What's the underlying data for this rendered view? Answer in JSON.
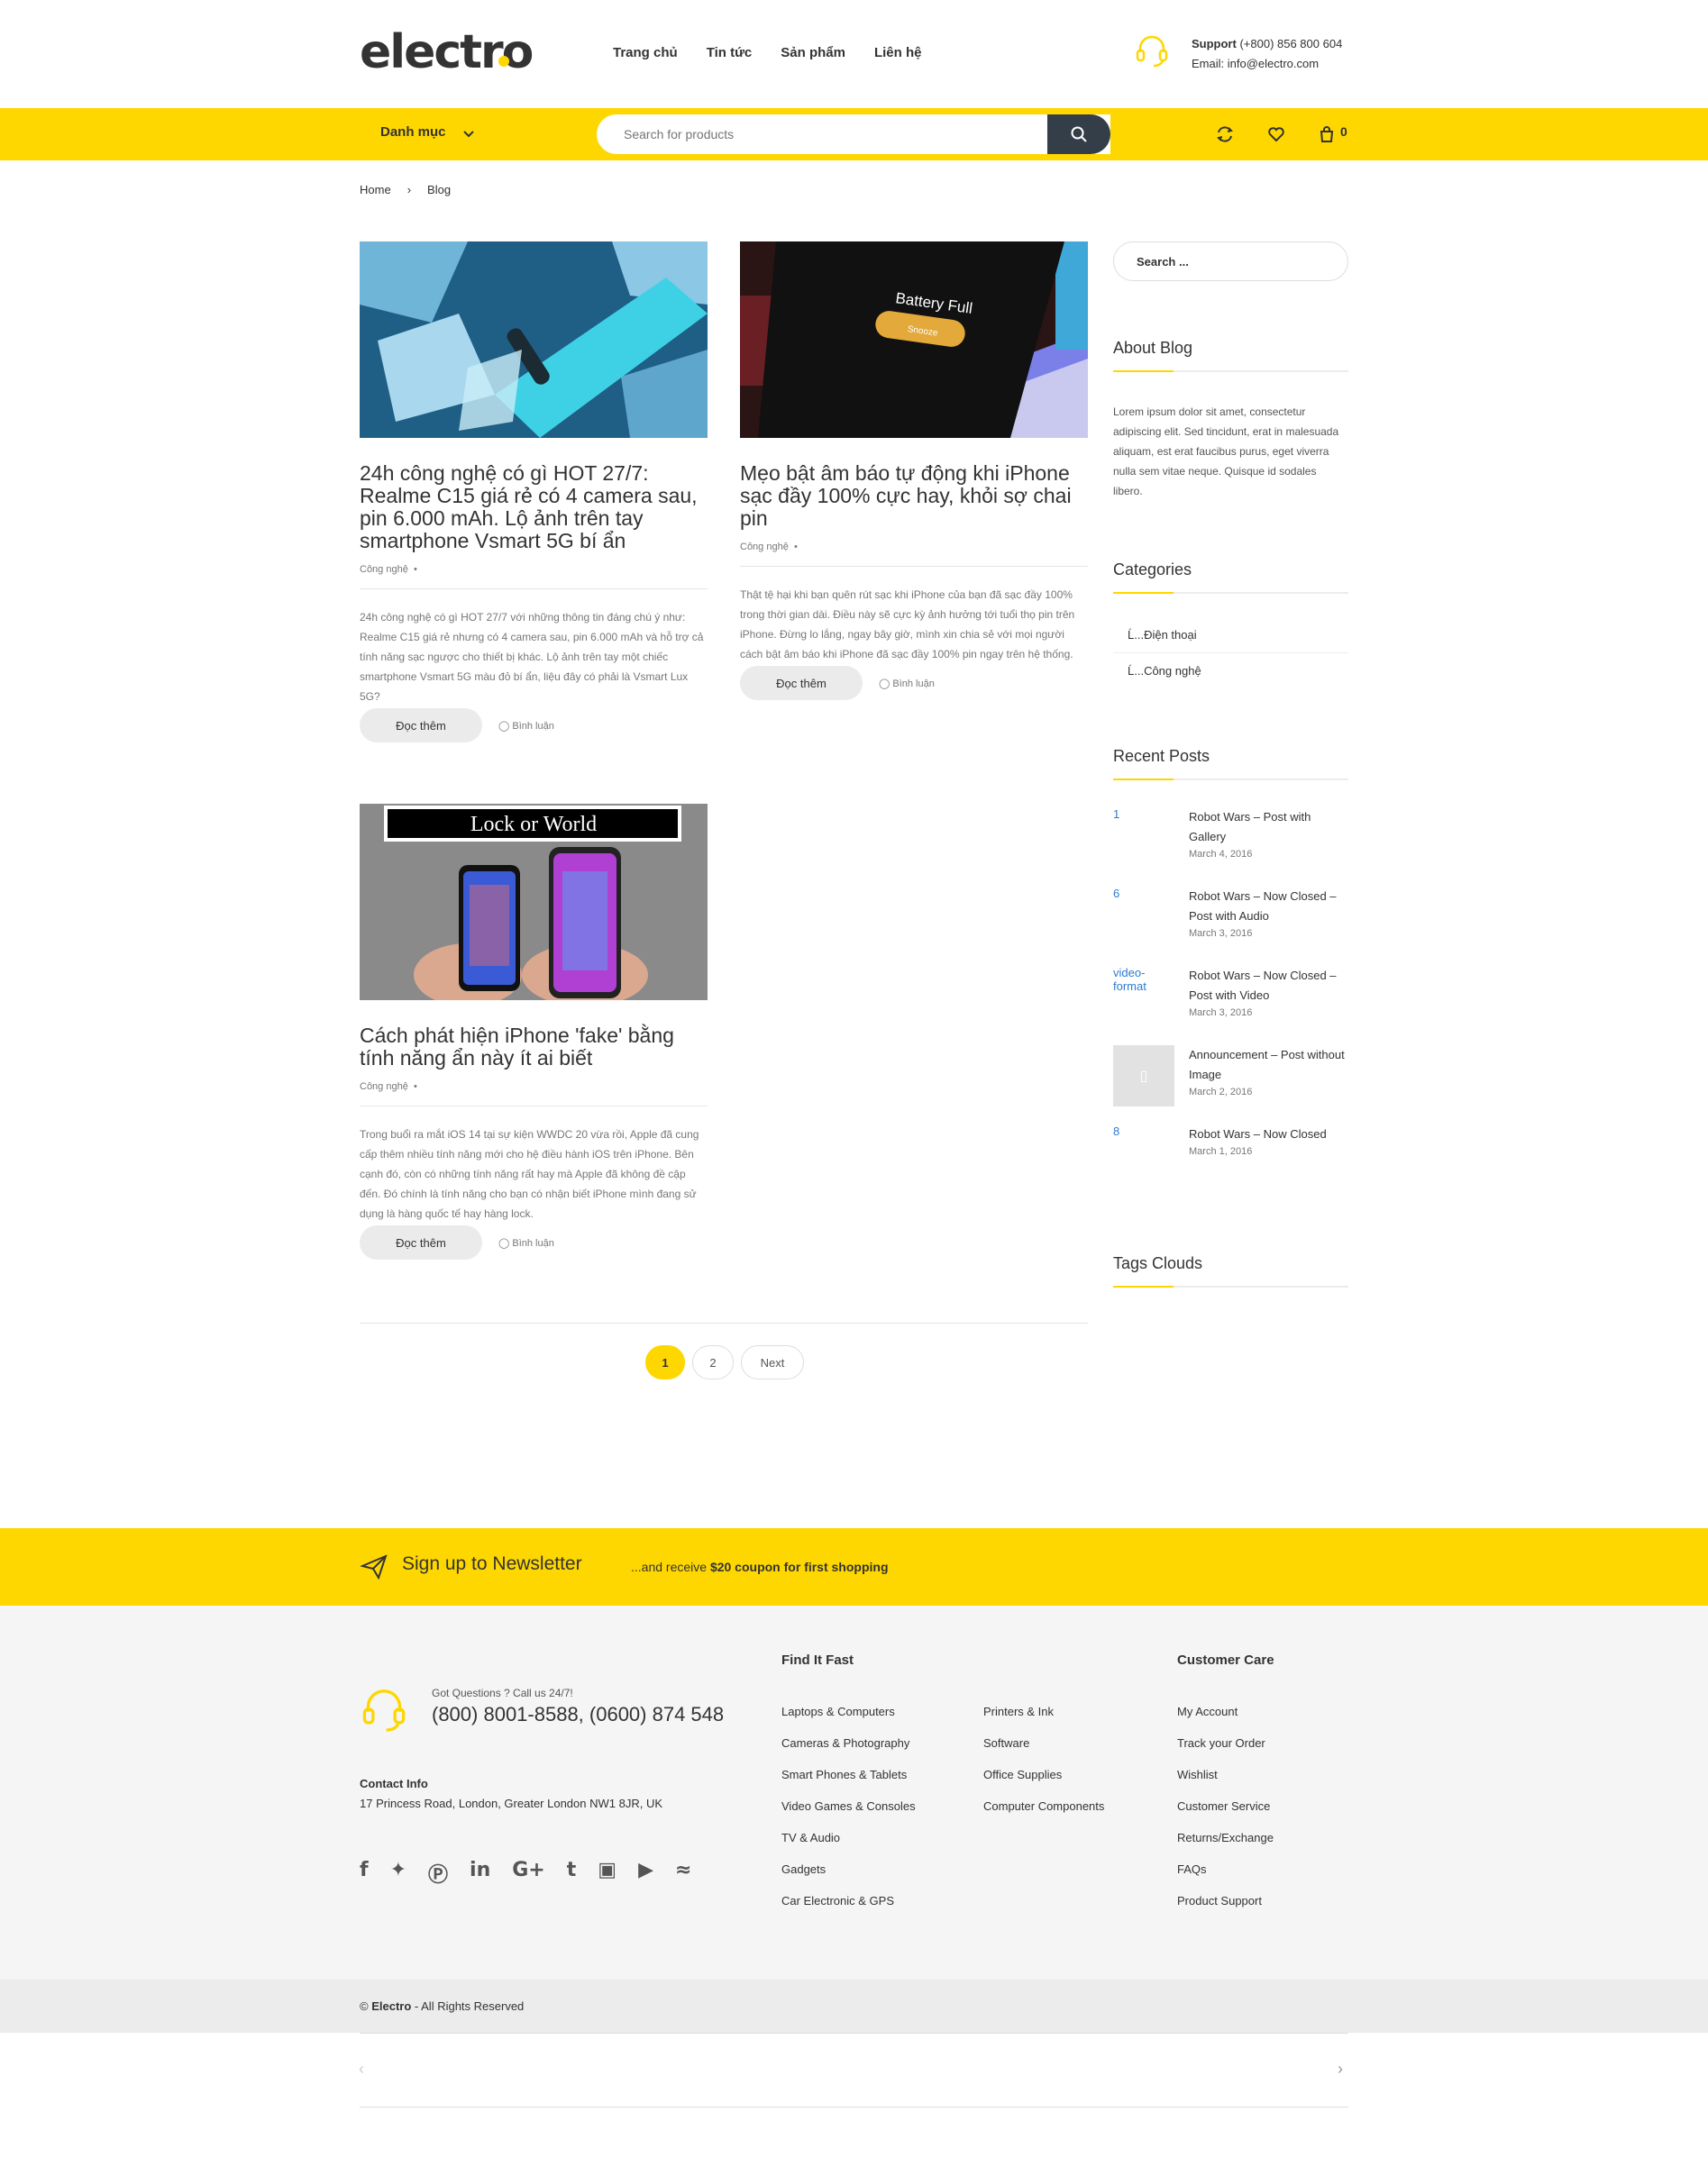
{
  "header": {
    "logo": "electro",
    "nav": [
      "Trang chủ",
      "Tin tức",
      "Sản phẩm",
      "Liên hệ"
    ],
    "support_label": "Support",
    "support_phone": "(+800) 856 800 604",
    "support_email": "Email: info@electro.com"
  },
  "bar": {
    "category_label": "Danh mục",
    "search_placeholder": "Search for products",
    "cart_count": "0"
  },
  "breadcrumb": {
    "home": "Home",
    "sep": "›",
    "current": "Blog"
  },
  "posts": [
    {
      "title": "24h công nghệ có gì HOT 27/7: Realme C15 giá rẻ có 4 camera sau, pin 6.000 mAh. Lộ ảnh trên tay smartphone Vsmart 5G bí ẩn",
      "category": "Công nghệ",
      "excerpt": "24h công nghệ có gì HOT 27/7 với những thông tin đáng chú ý như: Realme C15 giá rẻ nhưng có 4 camera sau, pin 6.000 mAh và hỗ trợ cả tính năng sạc ngược cho thiết bị khác. Lộ ảnh trên tay một chiếc smartphone Vsmart 5G màu đỏ bí ẩn, liệu đây có phải là Vsmart Lux 5G?",
      "read_more": "Đọc thêm",
      "comments": "Bình luận"
    },
    {
      "title": "Mẹo bật âm báo tự động khi iPhone sạc đầy 100% cực hay, khỏi sợ chai pin",
      "category": "Công nghệ",
      "excerpt": "Thật tệ hại khi bạn quên rút sạc khi iPhone của bạn đã sạc đầy 100% trong thời gian dài. Điều này sẽ cực kỳ ảnh hưởng tới tuổi thọ pin trên iPhone. Đừng lo lắng, ngay bây giờ, mình xin chia sẻ với mọi người cách bật âm báo khi iPhone đã sạc đầy 100% pin ngay trên hệ thống.",
      "read_more": "Đọc thêm",
      "comments": "Bình luận",
      "image_text": "Battery Full",
      "image_button": "Snooze"
    },
    {
      "title": "Cách phát hiện iPhone 'fake' bằng tính năng ẩn này ít ai biết",
      "category": "Công nghệ",
      "excerpt": "Trong buổi ra mắt iOS 14 tại sự kiện WWDC 20 vừa rồi, Apple đã cung cấp thêm nhiều tính năng mới cho hệ điều hành iOS trên iPhone. Bên cạnh đó, còn có những tính năng rất hay mà Apple đã không đề cập đến. Đó chính là tính năng cho bạn có nhận biết iPhone mình đang sử dụng là hàng quốc tế hay hàng lock.",
      "read_more": "Đọc thêm",
      "comments": "Bình luận",
      "image_text": "Lock or World"
    }
  ],
  "pagination": {
    "pages": [
      "1",
      "2"
    ],
    "next": "Next",
    "current": "1"
  },
  "sidebar": {
    "search_placeholder": "Search ...",
    "about_title": "About Blog",
    "about_text": "Lorem ipsum dolor sit amet, consectetur adipiscing elit. Sed tincidunt, erat in malesuada aliquam, est erat faucibus purus, eget viverra nulla sem vitae neque. Quisque id sodales libero.",
    "categories_title": "Categories",
    "categories": [
      "Ĺ...Điện thoại",
      "Ĺ...Công nghệ"
    ],
    "recent_title": "Recent Posts",
    "recent": [
      {
        "img_alt": "1",
        "title": "Robot Wars – Post with Gallery",
        "date": "March 4, 2016"
      },
      {
        "img_alt": "6",
        "title": "Robot Wars – Now Closed – Post with Audio",
        "date": "March 3, 2016"
      },
      {
        "img_alt": "video-format",
        "title": "Robot Wars – Now Closed – Post with Video",
        "date": "March 3, 2016"
      },
      {
        "img_alt": "",
        "title": "Announcement – Post without Image",
        "date": "March 2, 2016"
      },
      {
        "img_alt": "8",
        "title": "Robot Wars – Now Closed",
        "date": "March 1, 2016"
      }
    ],
    "tags_title": "Tags Clouds"
  },
  "newsletter": {
    "title": "Sign up to Newsletter",
    "prefix": "...and receive ",
    "bold": "$20 coupon for first shopping"
  },
  "footer": {
    "got_questions": "Got Questions ? Call us 24/7!",
    "phones": "(800) 8001-8588, (0600) 874 548",
    "contact_title": "Contact Info",
    "address": "17 Princess Road, London, Greater London NW1 8JR, UK",
    "find_title": "Find It Fast",
    "find_col1": [
      "Laptops & Computers",
      "Cameras & Photography",
      "Smart Phones & Tablets",
      "Video Games & Consoles",
      "TV & Audio",
      "Gadgets",
      "Car Electronic & GPS"
    ],
    "find_col2": [
      "Printers & Ink",
      "Software",
      "Office Supplies",
      "Computer Components"
    ],
    "care_title": "Customer Care",
    "care": [
      "My Account",
      "Track your Order",
      "Wishlist",
      "Customer Service",
      "Returns/Exchange",
      "FAQs",
      "Product Support"
    ],
    "social_icons": [
      "facebook-icon",
      "twitter-icon",
      "pinterest-icon",
      "linkedin-icon",
      "google-plus-icon",
      "tumblr-icon",
      "instagram-icon",
      "youtube-icon",
      "rss-icon"
    ],
    "copyright_symbol": "©",
    "copyright_brand": "Electro",
    "copyright_rest": " - All Rights Reserved"
  },
  "colors": {
    "accent": "#fed700",
    "dark": "#333e48"
  }
}
